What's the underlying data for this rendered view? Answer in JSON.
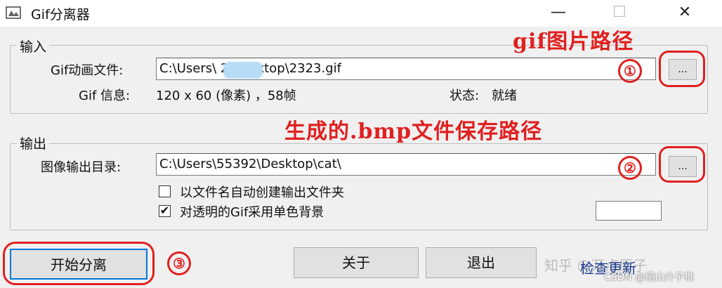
{
  "window": {
    "title": "Gif分离器",
    "min_icon": "minimize-icon",
    "max_icon": "maximize-icon",
    "close_icon": "close-icon",
    "min_glyph": "—",
    "max_glyph": "☐",
    "close_glyph": "✕"
  },
  "input_group": {
    "legend": "输入",
    "gif_label": "Gif动画文件:",
    "gif_path": "C:\\Users\\        2\\Desktop\\2323.gif",
    "browse_label": "...",
    "info_label": "Gif 信息:",
    "info_value": "120 x 60 (像素) ，58帧",
    "status_label": "状态:",
    "status_value": "就绪"
  },
  "output_group": {
    "legend": "输出",
    "dir_label": "图像输出目录:",
    "dir_path": "C:\\Users\\55392\\Desktop\\cat\\",
    "browse_label": "...",
    "option1_label": "以文件名自动创建输出文件夹",
    "option1_checked": false,
    "option2_label": "对透明的Gif采用单色背景",
    "option2_checked": true
  },
  "annotations": {
    "note_gif": "gif图片路径",
    "note_bmp": "生成的.bmp文件保存路径",
    "num1": "①",
    "num2": "②",
    "num3": "③",
    "color": "#e02020"
  },
  "buttons": {
    "start": "开始分离",
    "about": "关于",
    "exit": "退出",
    "check_update": "检查更新"
  },
  "watermarks": {
    "zhihu": "知乎 @万点原子",
    "csdn": "CSDN @缩山介子推"
  },
  "checkbox_glyph": "✔",
  "accent_color": "#0078d7"
}
